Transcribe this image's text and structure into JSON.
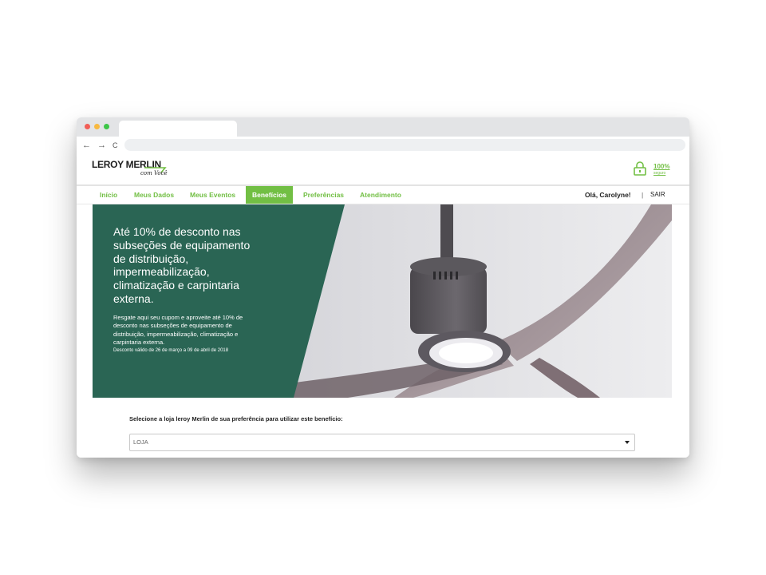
{
  "browser": {
    "back_icon": "←",
    "forward_icon": "→",
    "reload_icon": "C"
  },
  "header": {
    "logo_text": "LEROY MERLIN",
    "logo_tagline": "com Você",
    "security_badge": "100%",
    "security_badge_sub": "seguro"
  },
  "nav": {
    "items": [
      {
        "label": "Início"
      },
      {
        "label": "Meus Dados"
      },
      {
        "label": "Meus Eventos"
      },
      {
        "label": "Benefícios"
      },
      {
        "label": "Preferências"
      },
      {
        "label": "Atendimento"
      }
    ],
    "greeting": "Olá, Carolyne!",
    "separator": "|",
    "logout": "SAIR"
  },
  "banner": {
    "headline": "Até 10% de desconto nas subseções de equipamento de distribuição, impermeabilização, climatização e carpintaria externa.",
    "body": "Resgate aqui seu cupom e aproveite até 10% de desconto nas subseções de equipamento de distribuição, impermeabilização, climatização e carpintaria externa.",
    "validity": "Desconto válido de 26 de março a 09 de abril de 2018"
  },
  "store_select": {
    "label": "Selecione a loja leroy Merlin de sua preferência para utilizar este benefício:",
    "value": "LOJA"
  },
  "colors": {
    "brand_green": "#72bf44",
    "banner_teal": "#2a6554",
    "tab_bar": "#e3e4e6"
  },
  "icons": {
    "lock": "lock-icon",
    "dropdown": "caret-down-icon"
  }
}
